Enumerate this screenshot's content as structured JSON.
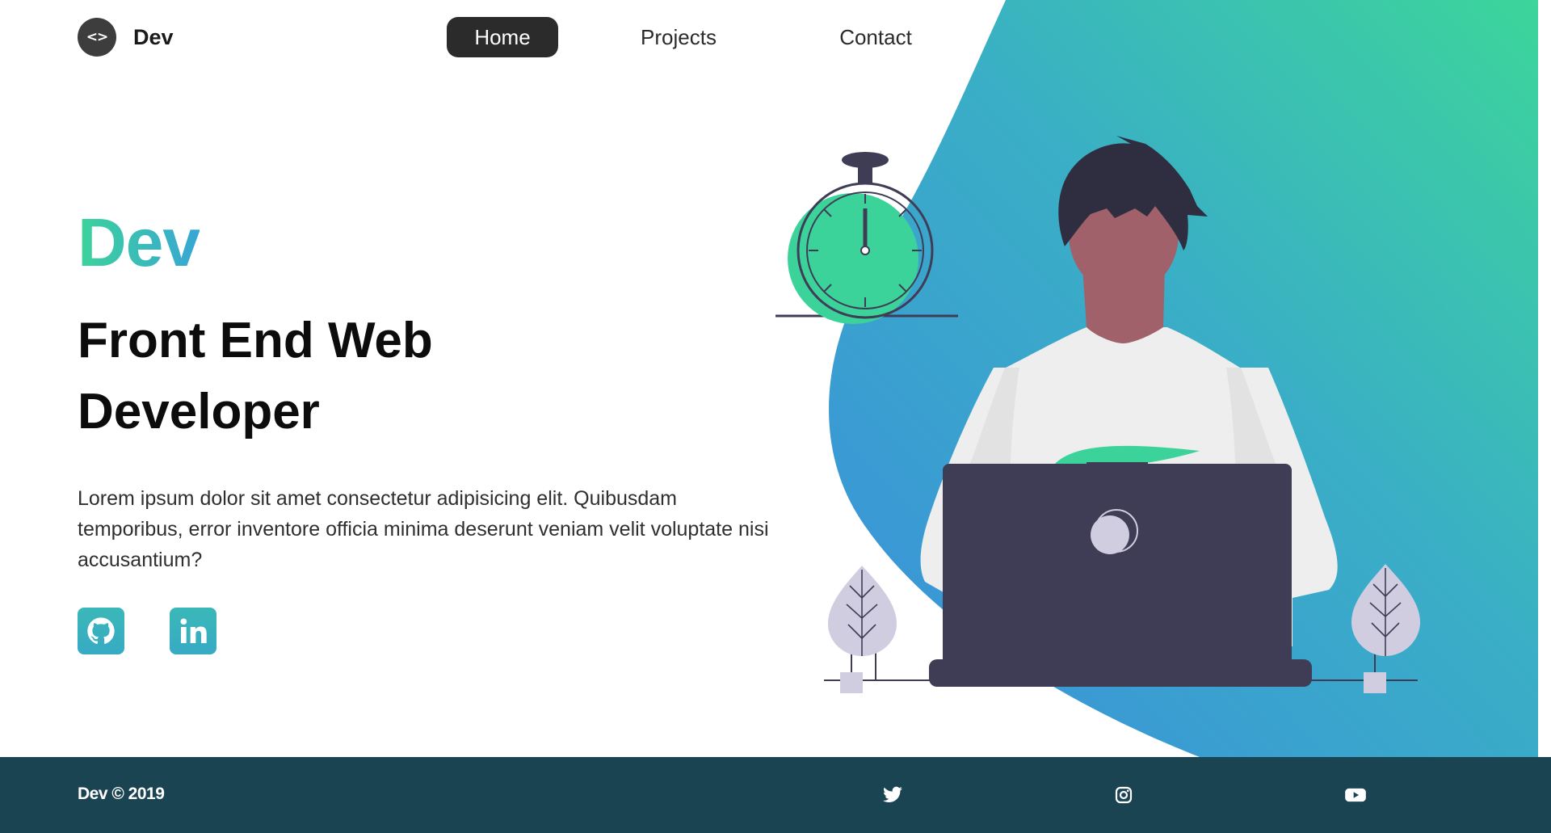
{
  "header": {
    "logo_badge": "<>",
    "logo_text": "Dev",
    "nav": [
      {
        "label": "Home",
        "active": true
      },
      {
        "label": "Projects",
        "active": false
      },
      {
        "label": "Contact",
        "active": false
      }
    ]
  },
  "hero": {
    "brand": "Dev",
    "title": "Front End Web Developer",
    "description": "Lorem ipsum dolor sit amet consectetur adipisicing elit. Quibusdam temporibus, error inventore officia minima deserunt veniam velit voluptate nisi accusantium?",
    "socials": [
      {
        "icon": "github-icon"
      },
      {
        "icon": "linkedin-icon"
      }
    ]
  },
  "footer": {
    "copyright": "Dev © 2019",
    "icons": [
      "twitter-icon",
      "instagram-icon",
      "youtube-icon"
    ]
  },
  "colors": {
    "accent_green": "#3cd39a",
    "accent_blue": "#38a6d4",
    "dark": "#2b2b2b",
    "footer_bg": "#1b4453",
    "laptop": "#3f3d56",
    "skin": "#a0616a"
  }
}
